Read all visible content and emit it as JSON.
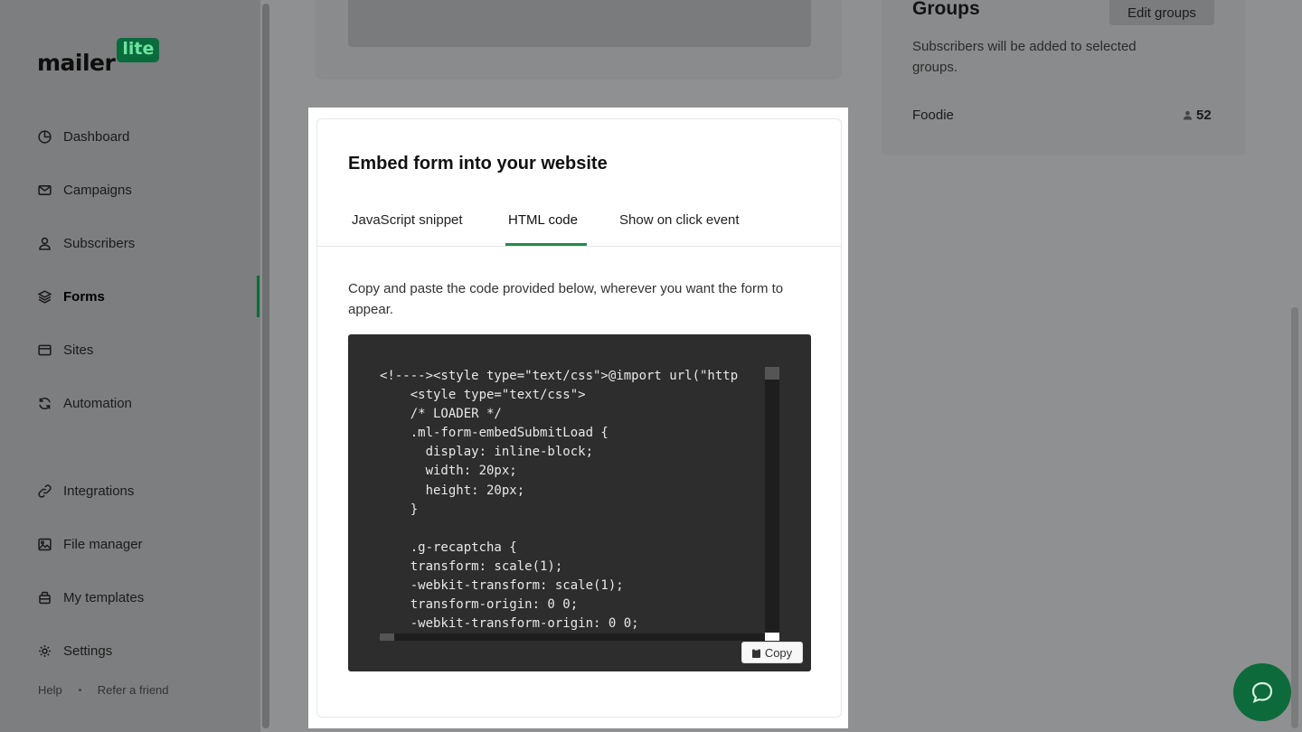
{
  "brand": {
    "name": "mailer",
    "badge": "lite"
  },
  "sidebar": {
    "items": [
      {
        "label": "Dashboard",
        "icon": "dashboard-icon"
      },
      {
        "label": "Campaigns",
        "icon": "mail-icon"
      },
      {
        "label": "Subscribers",
        "icon": "user-icon"
      },
      {
        "label": "Forms",
        "icon": "layers-icon",
        "active": true
      },
      {
        "label": "Sites",
        "icon": "browser-icon"
      },
      {
        "label": "Automation",
        "icon": "refresh-icon"
      },
      {
        "label": "Integrations",
        "icon": "link-icon"
      },
      {
        "label": "File manager",
        "icon": "image-icon"
      },
      {
        "label": "My templates",
        "icon": "briefcase-icon"
      },
      {
        "label": "Settings",
        "icon": "gear-icon"
      }
    ],
    "footer": {
      "help": "Help",
      "refer": "Refer a friend"
    }
  },
  "groups": {
    "title": "Groups",
    "edit_label": "Edit groups",
    "description": "Subscribers will be added to selected groups.",
    "items": [
      {
        "name": "Foodie",
        "count": "52"
      }
    ]
  },
  "modal": {
    "title": "Embed form into your website",
    "tabs": [
      {
        "label": "JavaScript snippet"
      },
      {
        "label": "HTML code",
        "active": true
      },
      {
        "label": "Show on click event"
      }
    ],
    "instructions": "Copy and paste the code provided below, wherever you want the form to appear.",
    "code_lines": [
      "<!----><style type=\"text/css\">@import url(\"http",
      "    <style type=\"text/css\">",
      "    /* LOADER */",
      "    .ml-form-embedSubmitLoad {",
      "      display: inline-block;",
      "      width: 20px;",
      "      height: 20px;",
      "    }",
      "",
      "    .g-recaptcha {",
      "    transform: scale(1);",
      "    -webkit-transform: scale(1);",
      "    transform-origin: 0 0;",
      "    -webkit-transform-origin: 0 0;"
    ],
    "copy_label": "Copy"
  },
  "colors": {
    "accent": "#1f8a52",
    "brand_green": "#0a6b3c",
    "code_bg": "#2d2d2d",
    "overlay_gray": "#8f9091"
  }
}
